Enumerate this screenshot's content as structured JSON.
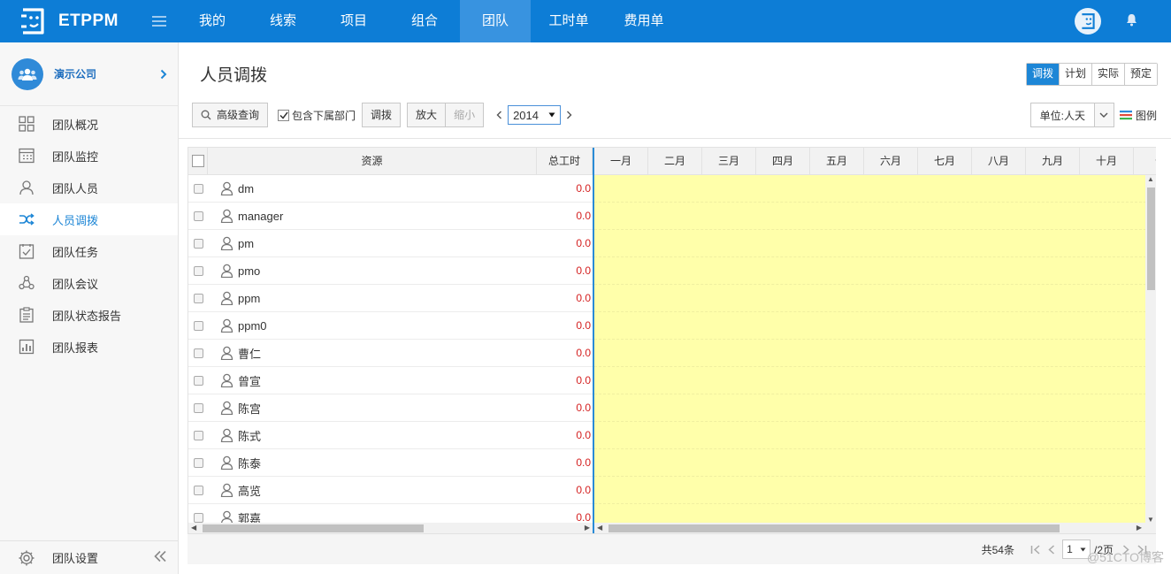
{
  "app": {
    "logo_text": "ETPPM"
  },
  "nav": {
    "items": [
      {
        "label": "我的",
        "active": false
      },
      {
        "label": "线索",
        "active": false
      },
      {
        "label": "项目",
        "active": false
      },
      {
        "label": "组合",
        "active": false
      },
      {
        "label": "团队",
        "active": true
      },
      {
        "label": "工时单",
        "active": false
      },
      {
        "label": "费用单",
        "active": false
      }
    ]
  },
  "sidebar": {
    "org_name": "演示公司",
    "items": [
      {
        "label": "团队概况",
        "icon": "grid-icon",
        "active": false
      },
      {
        "label": "团队监控",
        "icon": "calendar-icon",
        "active": false
      },
      {
        "label": "团队人员",
        "icon": "person-icon",
        "active": false
      },
      {
        "label": "人员调拨",
        "icon": "shuffle-icon",
        "active": true
      },
      {
        "label": "团队任务",
        "icon": "task-check-icon",
        "active": false
      },
      {
        "label": "团队会议",
        "icon": "meeting-icon",
        "active": false
      },
      {
        "label": "团队状态报告",
        "icon": "clipboard-icon",
        "active": false
      },
      {
        "label": "团队报表",
        "icon": "bar-report-icon",
        "active": false
      }
    ],
    "settings_label": "团队设置"
  },
  "page": {
    "title": "人员调拨",
    "view_modes": [
      {
        "label": "调拨",
        "active": true
      },
      {
        "label": "计划",
        "active": false
      },
      {
        "label": "实际",
        "active": false
      },
      {
        "label": "预定",
        "active": false
      }
    ]
  },
  "toolbar": {
    "advanced_search": "高级查询",
    "include_sub_dept": "包含下属部门",
    "allocate": "调拨",
    "zoom_in": "放大",
    "zoom_out": "缩小",
    "year": "2014",
    "unit": "单位:人天",
    "legend": "图例"
  },
  "grid": {
    "col_resource": "资源",
    "col_hours": "总工时",
    "months": [
      "一月",
      "二月",
      "三月",
      "四月",
      "五月",
      "六月",
      "七月",
      "八月",
      "九月",
      "十月",
      "十"
    ],
    "rows": [
      {
        "name": "dm",
        "hours": "0.0"
      },
      {
        "name": "manager",
        "hours": "0.0"
      },
      {
        "name": "pm",
        "hours": "0.0"
      },
      {
        "name": "pmo",
        "hours": "0.0"
      },
      {
        "name": "ppm",
        "hours": "0.0"
      },
      {
        "name": "ppm0",
        "hours": "0.0"
      },
      {
        "name": "曹仁",
        "hours": "0.0"
      },
      {
        "name": "曾宣",
        "hours": "0.0"
      },
      {
        "name": "陈宫",
        "hours": "0.0"
      },
      {
        "name": "陈式",
        "hours": "0.0"
      },
      {
        "name": "陈泰",
        "hours": "0.0"
      },
      {
        "name": "高览",
        "hours": "0.0"
      },
      {
        "name": "郭嘉",
        "hours": "0.0"
      }
    ]
  },
  "pagination": {
    "total": "共54条",
    "page": "1",
    "pages": "/2页"
  },
  "watermark": "@51CTO博客",
  "colors": {
    "brand": "#0d7dd6",
    "active_nav": "#3893e0",
    "grid_fill": "#ffffaa",
    "hours_text": "#d42020"
  }
}
